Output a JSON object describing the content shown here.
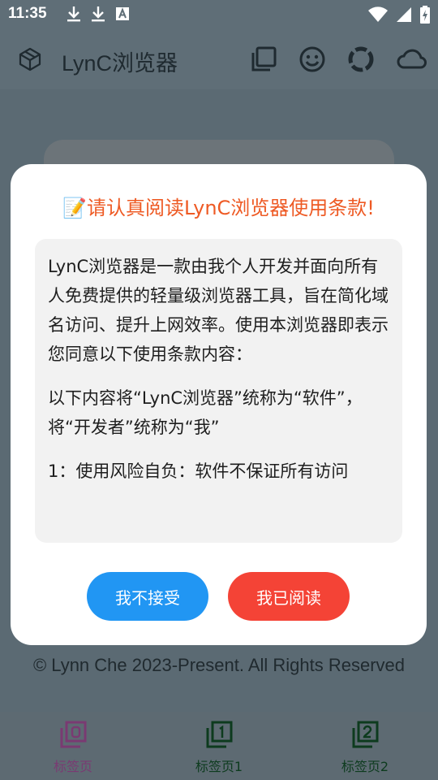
{
  "status_bar": {
    "time": "11:35",
    "icons": [
      "download-icon",
      "download-icon",
      "font-icon",
      "wifi-icon",
      "signal-icon",
      "battery-icon"
    ]
  },
  "app_bar": {
    "title": "LynC浏览器",
    "icons": [
      "logo-icon",
      "tabs-icon",
      "smile-icon",
      "loading-icon",
      "cloud-icon"
    ]
  },
  "footer": {
    "copyright": "© Lynn Che 2023-Present. All Rights Reserved"
  },
  "bottom_nav": {
    "tabs": [
      {
        "label": "标签页",
        "icon": "tab-0-icon"
      },
      {
        "label": "标签页1",
        "icon": "tab-1-icon"
      },
      {
        "label": "标签页2",
        "icon": "tab-2-icon"
      }
    ]
  },
  "dialog": {
    "title": "📝请认真阅读LynC浏览器使用条款!",
    "paragraphs": [
      "LynC浏览器是一款由我个人开发并面向所有人免费提供的轻量级浏览器工具，旨在简化域名访问、提升上网效率。使用本浏览器即表示您同意以下使用条款内容：",
      "以下内容将“LynC浏览器”统称为“软件”，将“开发者”统称为“我”",
      "1：使用风险自负：软件不保证所有访问"
    ],
    "decline_label": "我不接受",
    "accept_label": "我已阅读"
  },
  "colors": {
    "title_color": "#ee5a24",
    "decline_button": "#2196f3",
    "accept_button": "#f44336"
  }
}
